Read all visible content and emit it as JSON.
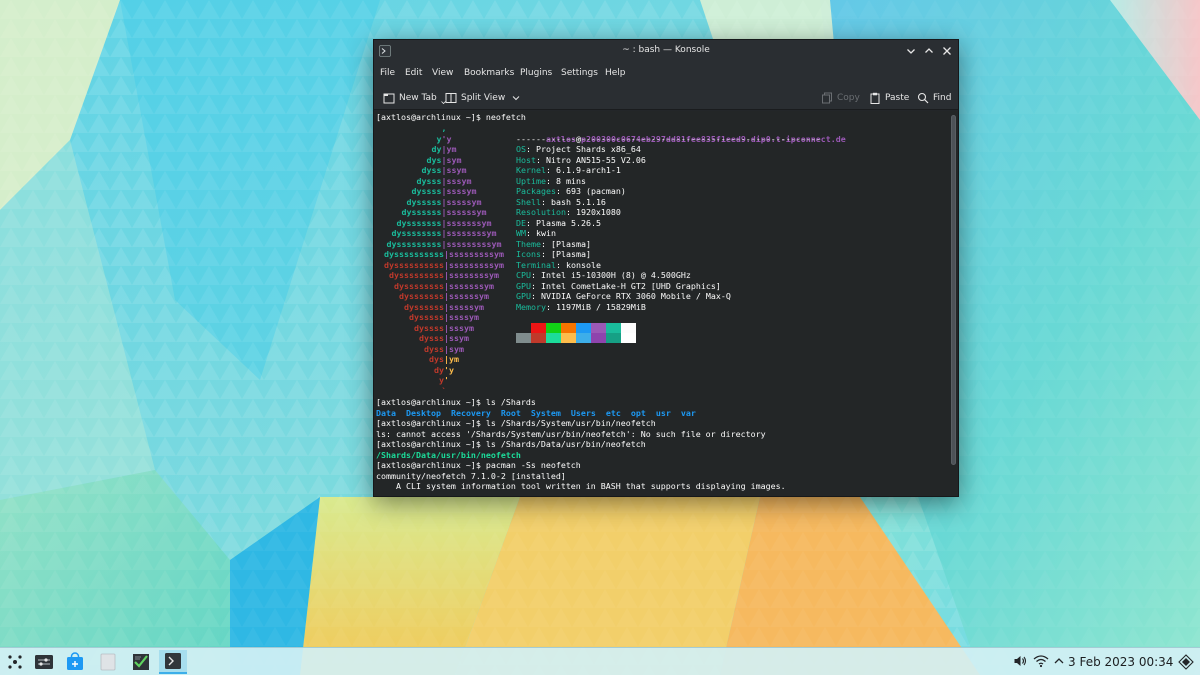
{
  "window": {
    "title": "~ : bash — Konsole",
    "menu": [
      "File",
      "Edit",
      "View",
      "Bookmarks",
      "Plugins",
      "Settings",
      "Help"
    ],
    "toolbar": {
      "new_tab": "New Tab",
      "split_view": "Split View",
      "copy": "Copy",
      "paste": "Paste",
      "find": "Find"
    }
  },
  "terminal": {
    "prompt_neofetch": "[axtlos@archlinux ~]$ neofetch",
    "user_host": {
      "user": "axtlos",
      "at": "@",
      "host": "p200300c0674eb297dd81fee835f1eed9.dip0.t-ipconnect.de"
    },
    "separator": "-------------------------------------------------------------",
    "info": [
      {
        "key": "OS",
        "value": "Project Shards x86_64"
      },
      {
        "key": "Host",
        "value": "Nitro AN515-55 V2.06"
      },
      {
        "key": "Kernel",
        "value": "6.1.9-arch1-1"
      },
      {
        "key": "Uptime",
        "value": "8 mins"
      },
      {
        "key": "Packages",
        "value": "693 (pacman)"
      },
      {
        "key": "Shell",
        "value": "bash 5.1.16"
      },
      {
        "key": "Resolution",
        "value": "1920x1080"
      },
      {
        "key": "DE",
        "value": "Plasma 5.26.5"
      },
      {
        "key": "WM",
        "value": "kwin"
      },
      {
        "key": "Theme",
        "value": "[Plasma]"
      },
      {
        "key": "Icons",
        "value": "[Plasma]"
      },
      {
        "key": "Terminal",
        "value": "konsole"
      },
      {
        "key": "CPU",
        "value": "Intel i5-10300H (8) @ 4.500GHz"
      },
      {
        "key": "GPU",
        "value": "Intel CometLake-H GT2 [UHD Graphics]"
      },
      {
        "key": "GPU",
        "value": "NVIDIA GeForce RTX 3060 Mobile / Max-Q"
      },
      {
        "key": "Memory",
        "value": "1197MiB / 15829MiB"
      }
    ],
    "logo": [
      {
        "left": ",",
        "right": "",
        "lc": "#1abc9c",
        "rc": "#9b59b6"
      },
      {
        "left": "y",
        "right": "'y",
        "lc": "#1abc9c",
        "rc": "#9b59b6"
      },
      {
        "left": "dy",
        "right": "|ym",
        "lc": "#1abc9c",
        "rc": "#9b59b6"
      },
      {
        "left": "dys",
        "right": "|sym",
        "lc": "#1abc9c",
        "rc": "#9b59b6"
      },
      {
        "left": "dyss",
        "right": "|ssym",
        "lc": "#1abc9c",
        "rc": "#9b59b6"
      },
      {
        "left": "dysss",
        "right": "|sssym",
        "lc": "#1abc9c",
        "rc": "#9b59b6"
      },
      {
        "left": "dyssss",
        "right": "|ssssym",
        "lc": "#1abc9c",
        "rc": "#9b59b6"
      },
      {
        "left": "dysssss",
        "right": "|sssssym",
        "lc": "#1abc9c",
        "rc": "#9b59b6"
      },
      {
        "left": "dyssssss",
        "right": "|ssssssym",
        "lc": "#1abc9c",
        "rc": "#9b59b6"
      },
      {
        "left": "dysssssss",
        "right": "|sssssssym",
        "lc": "#1abc9c",
        "rc": "#9b59b6"
      },
      {
        "left": "dyssssssss",
        "right": "|ssssssssym",
        "lc": "#1abc9c",
        "rc": "#9b59b6"
      },
      {
        "left": "dysssssssss",
        "right": "|sssssssssym",
        "lc": "#1abc9c",
        "rc": "#9b59b6"
      },
      {
        "left": "dyssssssssss",
        "right": "|sssssssssym",
        "lc": "#1abc9c",
        "rc": "#9b59b6"
      },
      {
        "left": "dyssssssssss",
        "right": "|sssssssssym",
        "lc": "#c0392b",
        "rc": "#9b59b6"
      },
      {
        "left": "dysssssssss",
        "right": "|ssssssssym",
        "lc": "#c0392b",
        "rc": "#9b59b6"
      },
      {
        "left": "dyssssssss",
        "right": "|sssssssym",
        "lc": "#c0392b",
        "rc": "#9b59b6"
      },
      {
        "left": "dysssssss",
        "right": "|ssssssym",
        "lc": "#c0392b",
        "rc": "#9b59b6"
      },
      {
        "left": "dyssssss",
        "right": "|sssssym",
        "lc": "#c0392b",
        "rc": "#9b59b6"
      },
      {
        "left": "dysssss",
        "right": "|ssssym",
        "lc": "#c0392b",
        "rc": "#9b59b6"
      },
      {
        "left": "dyssss",
        "right": "|sssym",
        "lc": "#c0392b",
        "rc": "#9b59b6"
      },
      {
        "left": "dysss",
        "right": "|ssym",
        "lc": "#c0392b",
        "rc": "#9b59b6"
      },
      {
        "left": "dyss",
        "right": "|sym",
        "lc": "#c0392b",
        "rc": "#9b59b6"
      },
      {
        "left": "dys",
        "right": "|ym",
        "lc": "#c0392b",
        "rc": "#fdbc4b"
      },
      {
        "left": "dy",
        "right": "'y",
        "lc": "#c0392b",
        "rc": "#fdbc4b"
      },
      {
        "left": "y",
        "right": "'",
        "lc": "#c0392b",
        "rc": "#fdbc4b"
      },
      {
        "left": "`",
        "right": "",
        "lc": "#c0392b",
        "rc": "#c0392b"
      }
    ],
    "palette_top": [
      "#232627",
      "#ed1515",
      "#11d116",
      "#f67400",
      "#1d99f3",
      "#9b59b6",
      "#1abc9c",
      "#fcfcfc"
    ],
    "palette_bottom": [
      "#7f8c8d",
      "#c0392b",
      "#1cdc9a",
      "#fdbc4b",
      "#3daee9",
      "#8e44ad",
      "#16a085",
      "#ffffff"
    ],
    "line_ls_shards": "[axtlos@archlinux ~]$ ls /Shards",
    "ls_dirs": [
      "Data",
      "Desktop",
      "Recovery",
      "Root",
      "System",
      "Users",
      "etc",
      "opt",
      "usr",
      "var"
    ],
    "line_ls_sys": "[axtlos@archlinux ~]$ ls /Shards/System/usr/bin/neofetch",
    "line_err": "ls: cannot access '/Shards/System/usr/bin/neofetch': No such file or directory",
    "line_ls_data": "[axtlos@archlinux ~]$ ls /Shards/Data/usr/bin/neofetch",
    "line_path": "/Shards/Data/usr/bin/neofetch",
    "line_pacman": "[axtlos@archlinux ~]$ pacman -Ss neofetch",
    "line_pkg": "community/neofetch 7.1.0-2 [installed]",
    "line_desc": "    A CLI system information tool written in BASH that supports displaying images."
  },
  "taskbar": {
    "clock": "3 Feb 2023 00:34"
  }
}
